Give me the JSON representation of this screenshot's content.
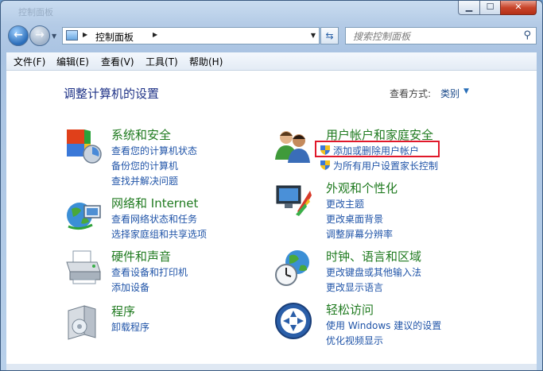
{
  "window": {
    "title": "控制面板"
  },
  "navigation": {
    "address_path": "控制面板",
    "search_placeholder": "搜索控制面板"
  },
  "menu": [
    "文件(F)",
    "编辑(E)",
    "查看(V)",
    "工具(T)",
    "帮助(H)"
  ],
  "main": {
    "title": "调整计算机的设置",
    "view_label": "查看方式:",
    "view_value": "类别"
  },
  "categories": {
    "system_security": {
      "title": "系统和安全",
      "links": [
        "查看您的计算机状态",
        "备份您的计算机",
        "查找并解决问题"
      ]
    },
    "network": {
      "title": "网络和 Internet",
      "links": [
        "查看网络状态和任务",
        "选择家庭组和共享选项"
      ]
    },
    "hardware": {
      "title": "硬件和声音",
      "links": [
        "查看设备和打印机",
        "添加设备"
      ]
    },
    "programs": {
      "title": "程序",
      "links": [
        "卸载程序"
      ]
    },
    "user_accounts": {
      "title": "用户帐户和家庭安全",
      "links": [
        "添加或删除用户帐户",
        "为所有用户设置家长控制"
      ]
    },
    "appearance": {
      "title": "外观和个性化",
      "links": [
        "更改主题",
        "更改桌面背景",
        "调整屏幕分辨率"
      ]
    },
    "clock": {
      "title": "时钟、语言和区域",
      "links": [
        "更改键盘或其他输入法",
        "更改显示语言"
      ]
    },
    "ease": {
      "title": "轻松访问",
      "links": [
        "使用 Windows 建议的设置",
        "优化视频显示"
      ]
    }
  },
  "colors": {
    "category_title": "#1f7a1f",
    "link": "#2054a8",
    "page_title": "#1e3287",
    "highlight": "#e0182a"
  }
}
